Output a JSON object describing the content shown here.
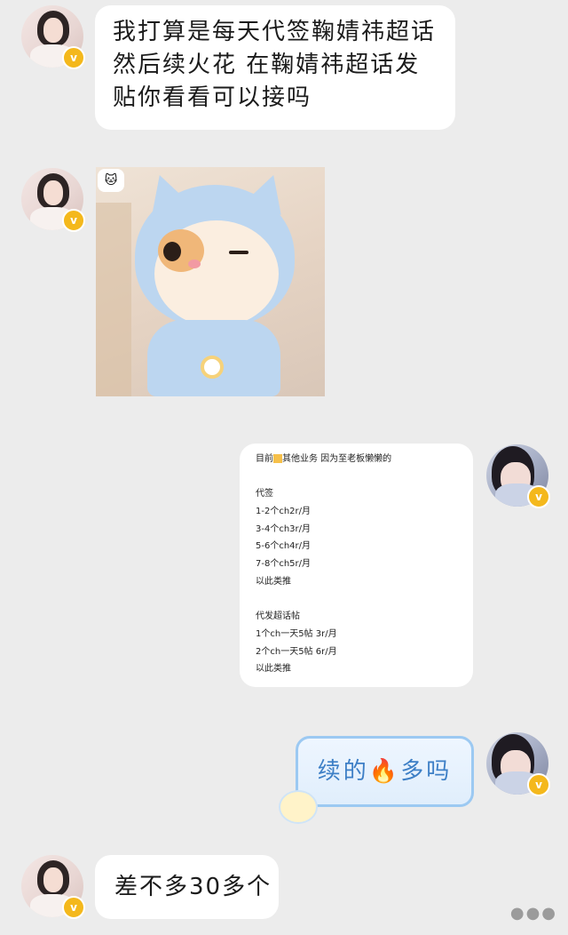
{
  "messages": {
    "m1": {
      "lines": [
        "我打算是每天代签鞠婧祎超话",
        "然后续火花 在鞠婧祎超话发",
        "贴你看看可以接吗"
      ]
    },
    "m3": {
      "header": "目前",
      "header_rest": "其他业务 因为至老板懒懒的",
      "lines": [
        "代签",
        "1-2个ch2r/月",
        "3-4个ch3r/月",
        "5-6个ch4r/月",
        "7-8个ch5r/月",
        "以此类推",
        "",
        "代发超话帖",
        "1个ch一天5帖  3r/月",
        "2个ch一天5帖  6r/月",
        "以此类推"
      ]
    },
    "m4": {
      "text_before": "续的",
      "emoji": "🔥",
      "text_after": "多吗"
    },
    "m5": {
      "text": "差不多30多个"
    }
  },
  "icons": {
    "verified": "v-badge-icon",
    "more": "more-dots-icon"
  },
  "colors": {
    "badge": "#f4b81c",
    "fire_bubble_border": "#9cc9f2",
    "fire_text": "#3d7fc6"
  }
}
